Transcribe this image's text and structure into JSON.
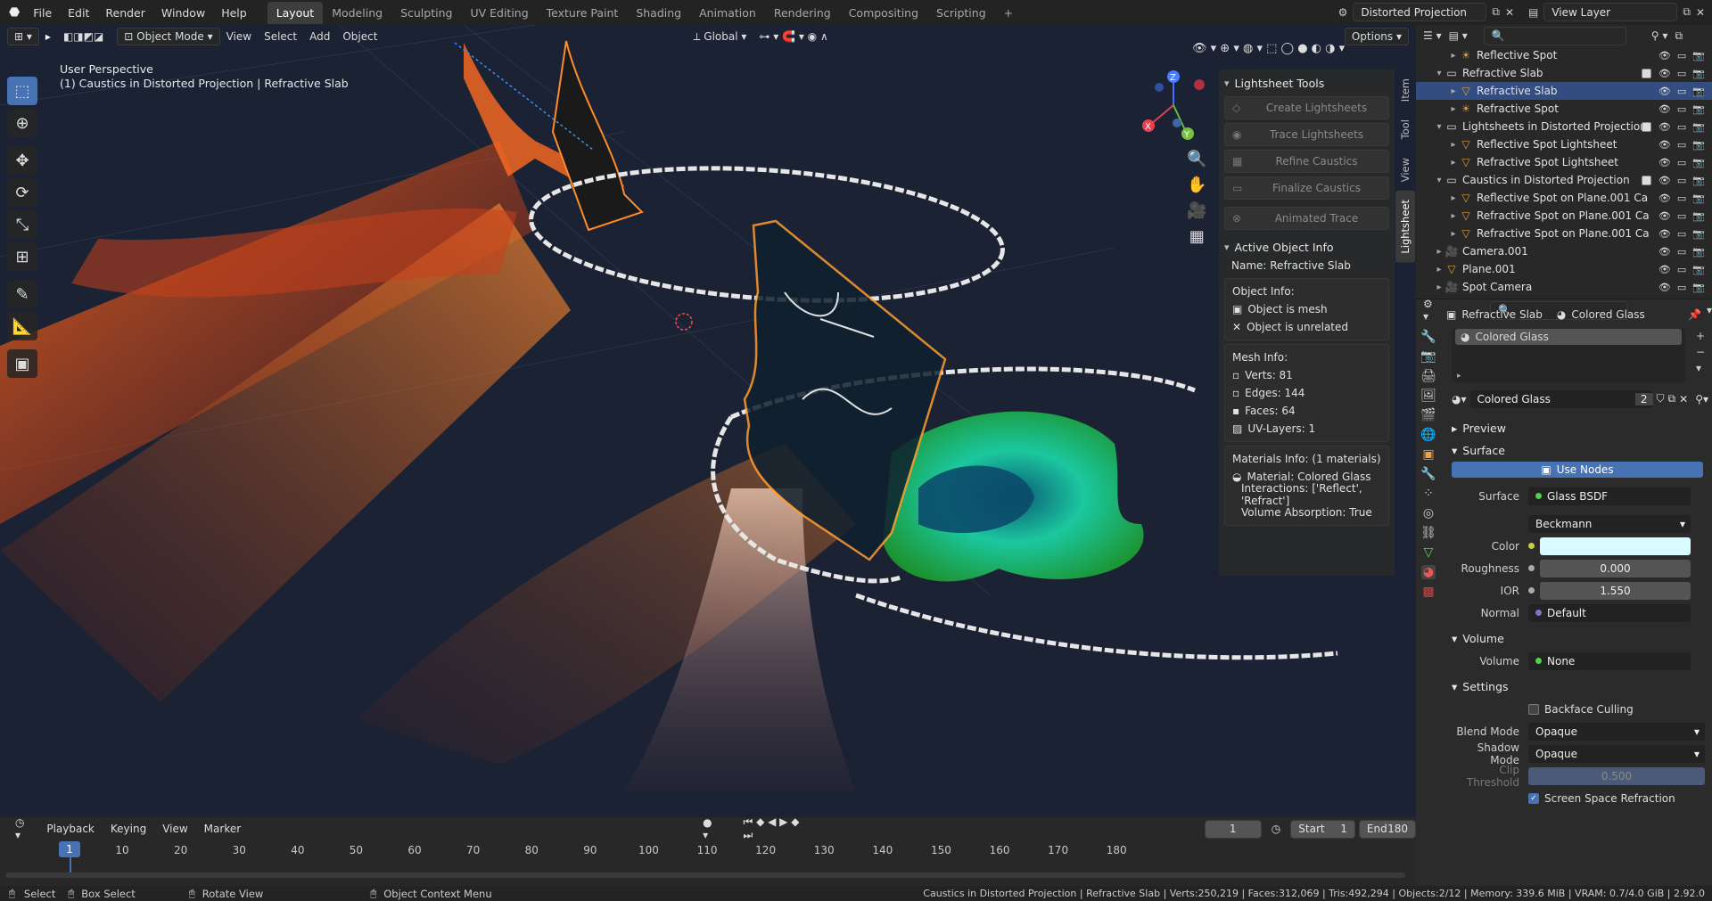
{
  "topbar": {
    "menus": [
      "File",
      "Edit",
      "Render",
      "Window",
      "Help"
    ],
    "workspaces": [
      "Layout",
      "Modeling",
      "Sculpting",
      "UV Editing",
      "Texture Paint",
      "Shading",
      "Animation",
      "Rendering",
      "Compositing",
      "Scripting"
    ],
    "active_workspace": "Layout",
    "scene": "Distorted Projection",
    "view_layer": "View Layer"
  },
  "viewport": {
    "mode": "Object Mode",
    "menus": [
      "View",
      "Select",
      "Add",
      "Object"
    ],
    "orientation": "Global",
    "options": "Options",
    "perspective": "User Perspective",
    "context": "(1) Caustics in Distorted Projection | Refractive Slab"
  },
  "npanel": {
    "tabs": [
      "Item",
      "Tool",
      "View",
      "Lightsheet"
    ],
    "active_tab": "Lightsheet",
    "tools_title": "Lightsheet Tools",
    "tools": [
      "Create Lightsheets",
      "Trace Lightsheets",
      "Refine Caustics",
      "Finalize Caustics",
      "Animated Trace"
    ],
    "info_title": "Active Object Info",
    "name_line": "Name: Refractive Slab",
    "object_info_title": "Object Info:",
    "object_info": [
      "Object is mesh",
      "Object is unrelated"
    ],
    "mesh_info_title": "Mesh Info:",
    "mesh_info": [
      "Verts: 81",
      "Edges: 144",
      "Faces: 64",
      "UV-Layers: 1"
    ],
    "materials_title": "Materials Info: (1 materials)",
    "material": "Material: Colored Glass",
    "interactions": "Interactions: ['Reflect', 'Refract']",
    "volume_absorption": "Volume Absorption: True"
  },
  "timeline": {
    "menus": [
      "Playback",
      "Keying",
      "View",
      "Marker"
    ],
    "current_frame": "1",
    "start_label": "Start",
    "start": "1",
    "end_label": "End",
    "end": "180",
    "ticks": [
      "1",
      "10",
      "20",
      "30",
      "40",
      "50",
      "60",
      "70",
      "80",
      "90",
      "100",
      "110",
      "120",
      "130",
      "140",
      "150",
      "160",
      "170",
      "180"
    ]
  },
  "outliner": {
    "rows": [
      {
        "name": "Reflective Spot",
        "indent": 2,
        "icon": "light",
        "sel": false,
        "chk": false
      },
      {
        "name": "Refractive Slab",
        "indent": 1,
        "icon": "collection",
        "sel": false,
        "chk": true
      },
      {
        "name": "Refractive Slab",
        "indent": 2,
        "icon": "mesh",
        "sel": true,
        "chk": false
      },
      {
        "name": "Refractive Spot",
        "indent": 2,
        "icon": "light",
        "sel": false,
        "chk": false
      },
      {
        "name": "Lightsheets in Distorted Projection",
        "indent": 1,
        "icon": "collection",
        "sel": false,
        "chk": true
      },
      {
        "name": "Reflective Spot Lightsheet",
        "indent": 2,
        "icon": "mesh",
        "sel": false,
        "chk": false
      },
      {
        "name": "Refractive Spot Lightsheet",
        "indent": 2,
        "icon": "mesh",
        "sel": false,
        "chk": false
      },
      {
        "name": "Caustics in Distorted Projection",
        "indent": 1,
        "icon": "collection",
        "sel": false,
        "chk": true
      },
      {
        "name": "Reflective Spot on Plane.001 Ca",
        "indent": 2,
        "icon": "mesh",
        "sel": false,
        "chk": false
      },
      {
        "name": "Refractive Spot on Plane.001 Ca",
        "indent": 2,
        "icon": "mesh",
        "sel": false,
        "chk": false
      },
      {
        "name": "Refractive Spot on Plane.001 Ca",
        "indent": 2,
        "icon": "mesh",
        "sel": false,
        "chk": false
      },
      {
        "name": "Camera.001",
        "indent": 1,
        "icon": "camera",
        "sel": false,
        "chk": false
      },
      {
        "name": "Plane.001",
        "indent": 1,
        "icon": "mesh",
        "sel": false,
        "chk": false
      },
      {
        "name": "Spot Camera",
        "indent": 1,
        "icon": "camera",
        "sel": false,
        "chk": false
      }
    ]
  },
  "properties": {
    "object": "Refractive Slab",
    "material": "Colored Glass",
    "slot": "Colored Glass",
    "users": "2",
    "sections": {
      "preview": "Preview",
      "surface": "Surface",
      "volume": "Volume",
      "settings": "Settings"
    },
    "use_nodes": "Use Nodes",
    "surface_label": "Surface",
    "surface_value": "Glass BSDF",
    "distribution": "Beckmann",
    "color_label": "Color",
    "roughness_label": "Roughness",
    "roughness": "0.000",
    "ior_label": "IOR",
    "ior": "1.550",
    "normal_label": "Normal",
    "normal": "Default",
    "volume_label": "Volume",
    "volume_value": "None",
    "backface_culling": "Backface Culling",
    "blend_mode_label": "Blend Mode",
    "blend_mode": "Opaque",
    "shadow_mode_label": "Shadow Mode",
    "shadow_mode": "Opaque",
    "clip_threshold_label": "Clip Threshold",
    "clip_threshold": "0.500",
    "ssr": "Screen Space Refraction"
  },
  "statusbar": {
    "select": "Select",
    "box_select": "Box Select",
    "rotate_view": "Rotate View",
    "context_menu": "Object Context Menu",
    "stats": "Caustics in Distorted Projection | Refractive Slab | Verts:250,219 | Faces:312,069 | Tris:492,294 | Objects:2/12 | Memory: 339.6 MiB | VRAM: 0.7/4.0 GiB | 2.92.0"
  },
  "colors": {
    "accent": "#4772b3",
    "viewport_bg": "#1a2234",
    "selection": "#334d80",
    "glass_color": "#d8fbff"
  }
}
